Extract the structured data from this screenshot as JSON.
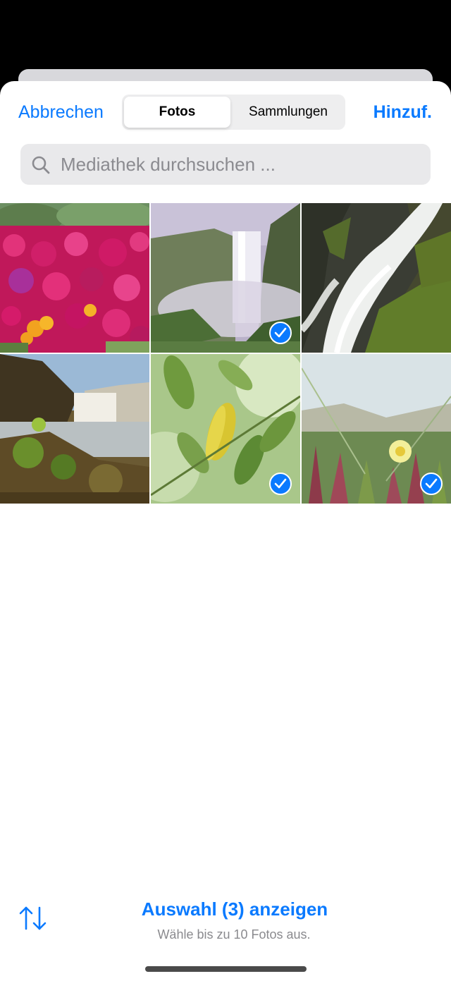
{
  "nav": {
    "cancel_label": "Abbrechen",
    "add_label": "Hinzuf."
  },
  "segments": {
    "photos_label": "Fotos",
    "collections_label": "Sammlungen"
  },
  "search": {
    "placeholder": "Mediathek durchsuchen ...",
    "icon": "magnifier-icon"
  },
  "photos": [
    {
      "subject": "pink and yellow flowers",
      "selected": false
    },
    {
      "subject": "waterfall in misty valley",
      "selected": true
    },
    {
      "subject": "long exposure waterfall over mossy rocks",
      "selected": false
    },
    {
      "subject": "waterfall with mossy foreground",
      "selected": false
    },
    {
      "subject": "green leaves with yellow leaf",
      "selected": true
    },
    {
      "subject": "ice plant flower by the coast",
      "selected": true
    }
  ],
  "footer": {
    "show_selection_label": "Auswahl (3) anzeigen",
    "hint": "Wähle bis zu 10 Fotos aus.",
    "sort_icon": "sort-arrows-icon"
  },
  "colors": {
    "accent": "#0a7aff"
  }
}
